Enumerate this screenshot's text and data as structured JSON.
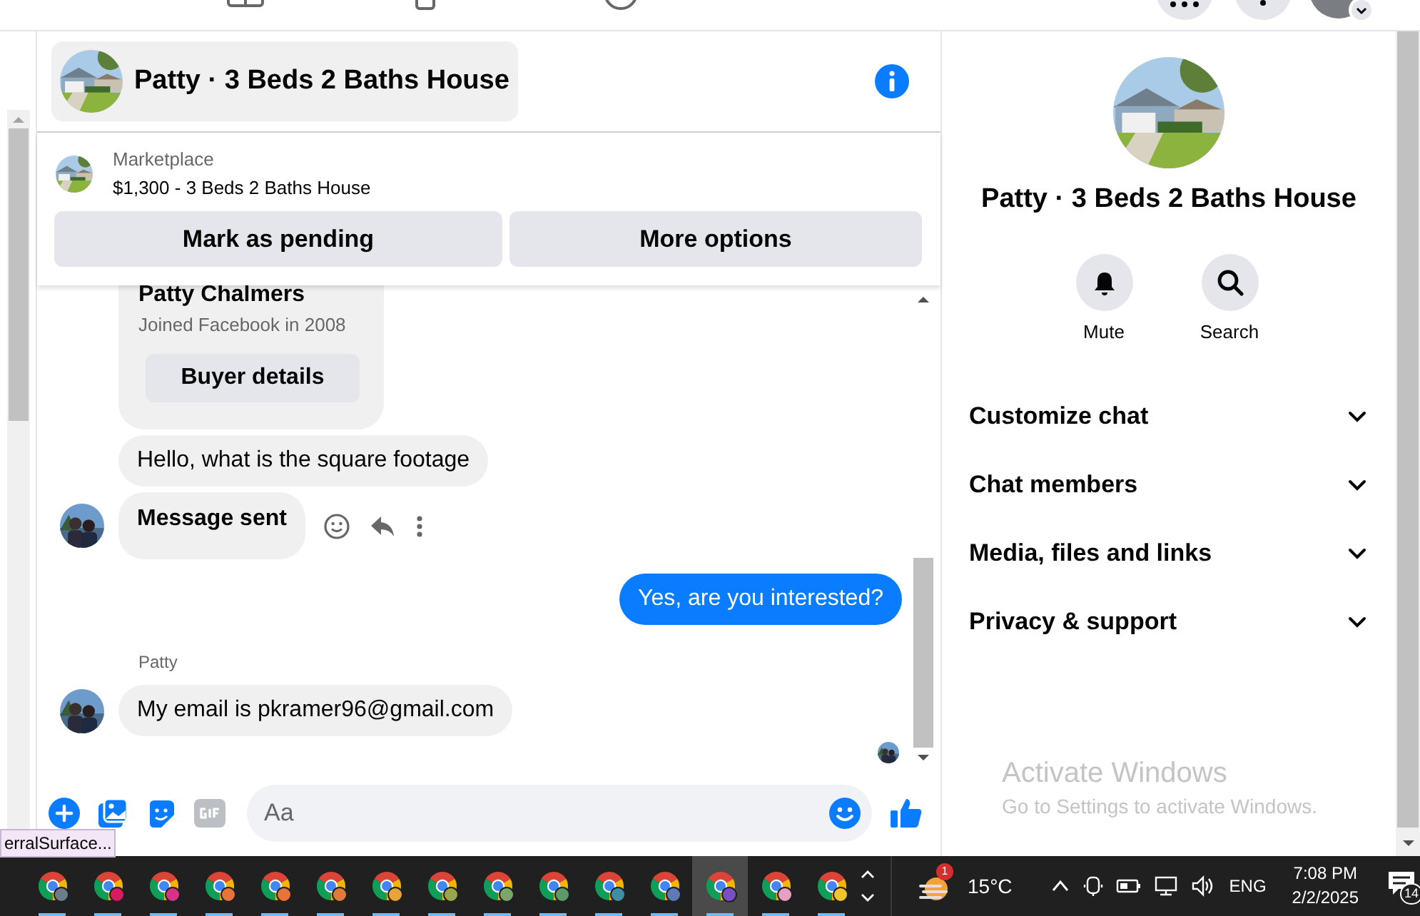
{
  "header": {
    "title": "Patty · 3 Beds 2 Baths House"
  },
  "listing": {
    "source": "Marketplace",
    "title": "$1,300 - 3 Beds 2 Baths House",
    "buttons": [
      "Mark as pending",
      "More options"
    ]
  },
  "messages": [
    {
      "kind": "card",
      "name": "Patty Chalmers",
      "subtitle": "Joined Facebook in 2008",
      "button": "Buyer details"
    },
    {
      "kind": "incoming",
      "text": "Hello, what is the square footage",
      "avatar": false,
      "actions": false
    },
    {
      "kind": "status",
      "text": "Message sent",
      "avatar": true,
      "actions": true
    },
    {
      "kind": "outgoing",
      "text": "Yes, are you interested?"
    },
    {
      "kind": "label",
      "text": "Patty"
    },
    {
      "kind": "incoming",
      "text": "My email is pkramer96@gmail.com",
      "avatar": true,
      "actions": false
    },
    {
      "kind": "seen"
    }
  ],
  "composer": {
    "placeholder": "Aa"
  },
  "details": {
    "title": "Patty · 3 Beds 2 Baths House",
    "actions": [
      {
        "kind": "mute",
        "label": "Mute"
      },
      {
        "kind": "search",
        "label": "Search"
      }
    ],
    "sections": [
      {
        "label": "Customize chat",
        "expanded": false
      },
      {
        "label": "Chat members",
        "expanded": false
      },
      {
        "label": "Media, files and links",
        "expanded": false
      },
      {
        "label": "Privacy & support",
        "expanded": false
      }
    ]
  },
  "activation": {
    "title": "Activate Windows",
    "text": "Go to Settings to activate Windows."
  },
  "tooltip": "erralSurface...",
  "taskbar": {
    "apps": [
      {
        "color": "#6b7c8a",
        "selected": false
      },
      {
        "color": "#d81b60",
        "selected": false
      },
      {
        "color": "#d63384",
        "selected": false
      },
      {
        "color": "#e8743b",
        "selected": false
      },
      {
        "color": "#e8743b",
        "selected": false
      },
      {
        "color": "#e07b39",
        "selected": false
      },
      {
        "color": "#e8a33b",
        "selected": false
      },
      {
        "color": "#9aa64b",
        "selected": false
      },
      {
        "color": "#7aa66b",
        "selected": false
      },
      {
        "color": "#5a9a6b",
        "selected": false
      },
      {
        "color": "#3d8fa6",
        "selected": false
      },
      {
        "color": "#5a7ab8",
        "selected": false
      },
      {
        "color": "#7a4fc4",
        "selected": true
      },
      {
        "color": "#e8a0c0",
        "selected": false
      },
      {
        "color": "#f4c430",
        "selected": false
      }
    ],
    "weather_badge": "1",
    "temperature": "15°C",
    "language": "ENG",
    "time": "7:08 PM",
    "date": "2/2/2025",
    "notifications": "14"
  }
}
